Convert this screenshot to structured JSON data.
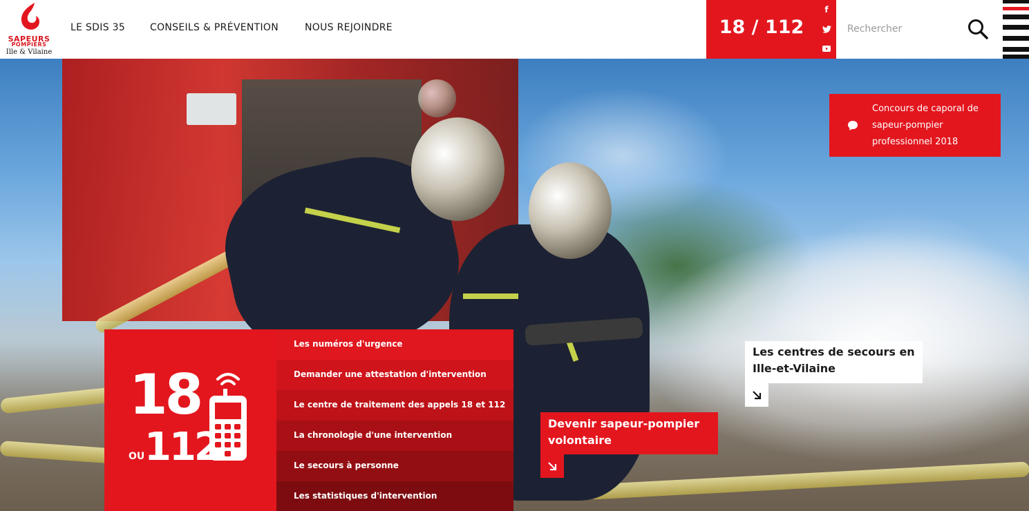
{
  "brand": {
    "line1": "SAPEURS",
    "line2": "POMPIERS",
    "line3": "Ille & Vilaine",
    "colors": {
      "red": "#e3161e",
      "dark": "#1a1a1a"
    }
  },
  "nav": {
    "items": [
      {
        "label": "LE SDIS 35"
      },
      {
        "label": "CONSEILS & PRÉVENTION"
      },
      {
        "label": "NOUS REJOINDRE"
      }
    ]
  },
  "header": {
    "emergency_number": "18 / 112",
    "social": [
      {
        "icon": "facebook-icon",
        "label": "f"
      },
      {
        "icon": "twitter-icon"
      },
      {
        "icon": "youtube-icon"
      }
    ],
    "search_placeholder": "Rechercher"
  },
  "news": {
    "text": "Concours de caporal de sapeur-pompier professionnel 2018",
    "icon": "speech-bubble-icon"
  },
  "emergency_block": {
    "big_18": "18",
    "ou": "OU",
    "big_112": "112",
    "links": [
      {
        "label": "Les numéros d'urgence"
      },
      {
        "label": "Demander une attestation d'intervention"
      },
      {
        "label": "Le centre de traitement des appels 18 et 112"
      },
      {
        "label": "La chronologie d'une intervention"
      },
      {
        "label": "Le secours à personne"
      },
      {
        "label": "Les statistiques d'intervention"
      }
    ]
  },
  "cta": {
    "volunteer": "Devenir sapeur-pompier volontaire",
    "centres": "Les centres de secours en Ille-et-Vilaine"
  }
}
